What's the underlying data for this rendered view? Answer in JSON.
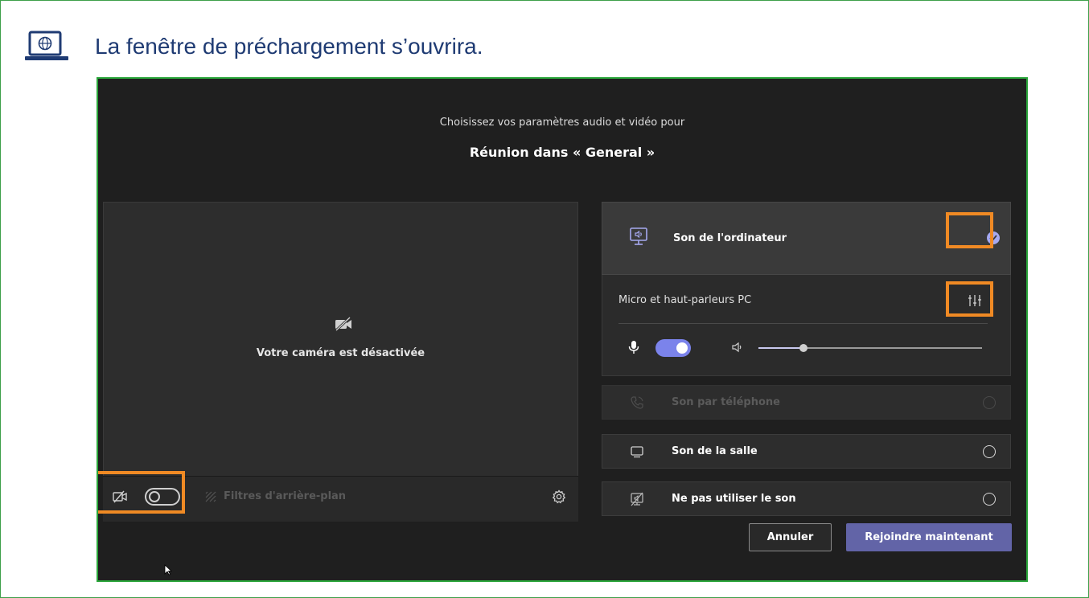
{
  "instruction": {
    "text": "La fenêtre de préchargement s’ouvrira."
  },
  "dialog": {
    "subtitle": "Choisissez vos paramètres audio et vidéo pour",
    "title": "Réunion dans « General »"
  },
  "video": {
    "camera_off_text": "Votre caméra est désactivée",
    "camera_toggle_on": false,
    "background_filters_label": "Filtres d'arrière-plan"
  },
  "audio": {
    "computer_audio": {
      "label": "Son de l'ordinateur",
      "selected": true
    },
    "device_label": "Micro et haut-parleurs PC",
    "mic_toggle_on": true,
    "speaker_volume_fraction": 0.2,
    "options": [
      {
        "label": "Son par téléphone",
        "disabled": true,
        "icon": "phone-icon"
      },
      {
        "label": "Son de la salle",
        "disabled": false,
        "icon": "room-audio-icon"
      },
      {
        "label": "Ne pas utiliser le son",
        "disabled": false,
        "icon": "no-audio-icon"
      }
    ]
  },
  "buttons": {
    "cancel_label": "Annuler",
    "join_label": "Rejoindre maintenant"
  },
  "colors": {
    "accent": "#6264a7",
    "toggle_on": "#7b83eb",
    "highlight": "#f08a24",
    "frame_green": "#3ea04a",
    "instruction_text": "#1f3b73"
  }
}
